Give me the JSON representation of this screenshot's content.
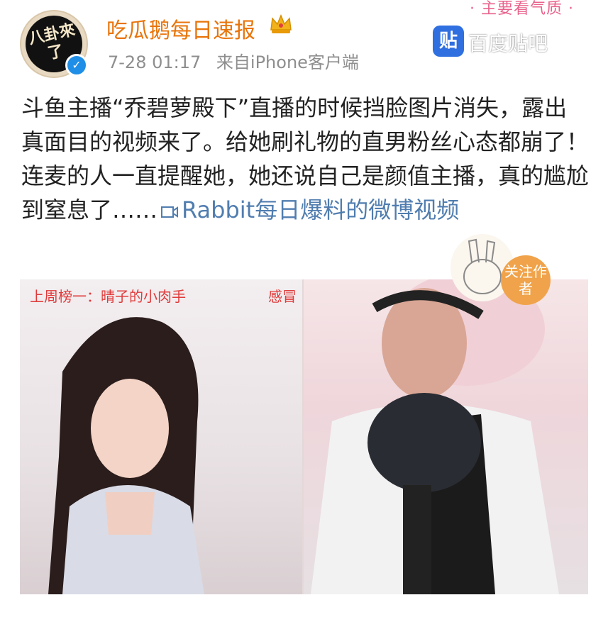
{
  "corner_text": "· 主要看气质 ·",
  "header": {
    "username": "吃瓜鹅每日速报",
    "time": "7-28 01:17",
    "source": "来自iPhone客户端",
    "avatar_text": "八卦來了"
  },
  "post": {
    "text": "斗鱼主播“乔碧萝殿下”直播的时候挡脸图片消失，露出真面目的视频来了。给她刷礼物的直男粉丝心态都崩了！连麦的人一直提醒她，她还说自己是颜值主播，真的尴尬到窒息了……",
    "video_link": "Rabbit每日爆料的微博视频"
  },
  "video": {
    "left_overlay": "上周榜一：晴子的小肉手",
    "right_overlay": "感冒",
    "badge_char": "贴",
    "badge_text": "百度贴吧",
    "follow": "关注作者"
  },
  "colors": {
    "username": "#e8740a",
    "link": "#507daf",
    "overlay": "#e03a3a",
    "verified": "#1f8ee6"
  }
}
